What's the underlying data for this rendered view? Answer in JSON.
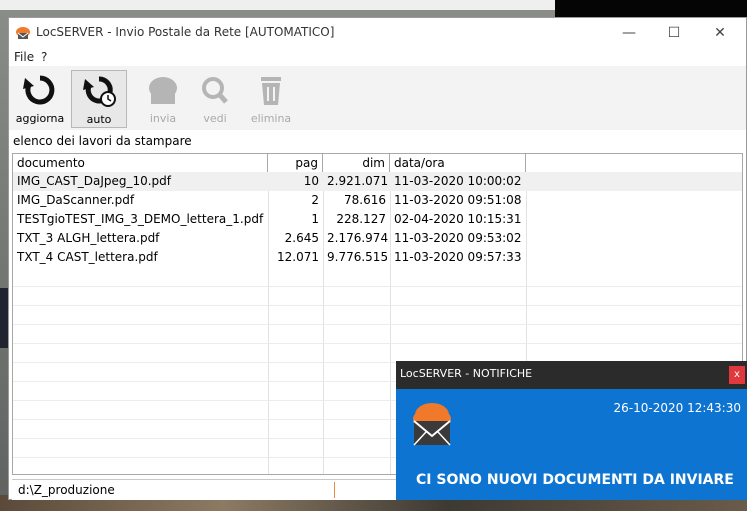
{
  "window": {
    "title": "LocSERVER - Invio Postale da Rete [AUTOMATICO]",
    "controls": {
      "minimize": "—",
      "maximize": "☐",
      "close": "✕"
    }
  },
  "menu": [
    "File",
    "?"
  ],
  "toolbar": {
    "buttons": [
      {
        "label": "aggiorna",
        "icon": "refresh-icon",
        "enabled": true
      },
      {
        "label": "auto",
        "icon": "auto-refresh-clock-icon",
        "enabled": true,
        "selected": true
      },
      {
        "label": "invia",
        "icon": "send-icon",
        "enabled": false
      },
      {
        "label": "vedi",
        "icon": "magnifier-icon",
        "enabled": false
      },
      {
        "label": "elimina",
        "icon": "trash-icon",
        "enabled": false
      }
    ]
  },
  "section_label": "elenco dei lavori da stampare",
  "grid": {
    "columns": [
      "documento",
      "pag",
      "dim",
      "data/ora"
    ],
    "rows": [
      {
        "documento": "IMG_CAST_DaJpeg_10.pdf",
        "pag": "10",
        "dim": "2.921.071",
        "data_ora": "11-03-2020 10:00:02"
      },
      {
        "documento": "IMG_DaScanner.pdf",
        "pag": "2",
        "dim": "78.616",
        "data_ora": "11-03-2020 09:51:08"
      },
      {
        "documento": "TESTgioTEST_IMG_3_DEMO_lettera_1.pdf",
        "pag": "1",
        "dim": "228.127",
        "data_ora": "02-04-2020 10:15:31"
      },
      {
        "documento": "TXT_3 ALGH_lettera.pdf",
        "pag": "2.645",
        "dim": "2.176.974",
        "data_ora": "11-03-2020 09:53:02"
      },
      {
        "documento": "TXT_4 CAST_lettera.pdf",
        "pag": "12.071",
        "dim": "9.776.515",
        "data_ora": "11-03-2020 09:57:33"
      }
    ]
  },
  "status": {
    "path": "d:\\Z_produzione"
  },
  "notification": {
    "title": "LocSERVER - NOTIFICHE",
    "close": "x",
    "timestamp": "26-10-2020 12:43:30",
    "message": "CI SONO NUOVI DOCUMENTI DA INVIARE"
  },
  "colors": {
    "notif_bg": "#0d74d1",
    "notif_head": "#2b2b2b",
    "close_red": "#e0383d",
    "brand_orange": "#f07a2a"
  }
}
